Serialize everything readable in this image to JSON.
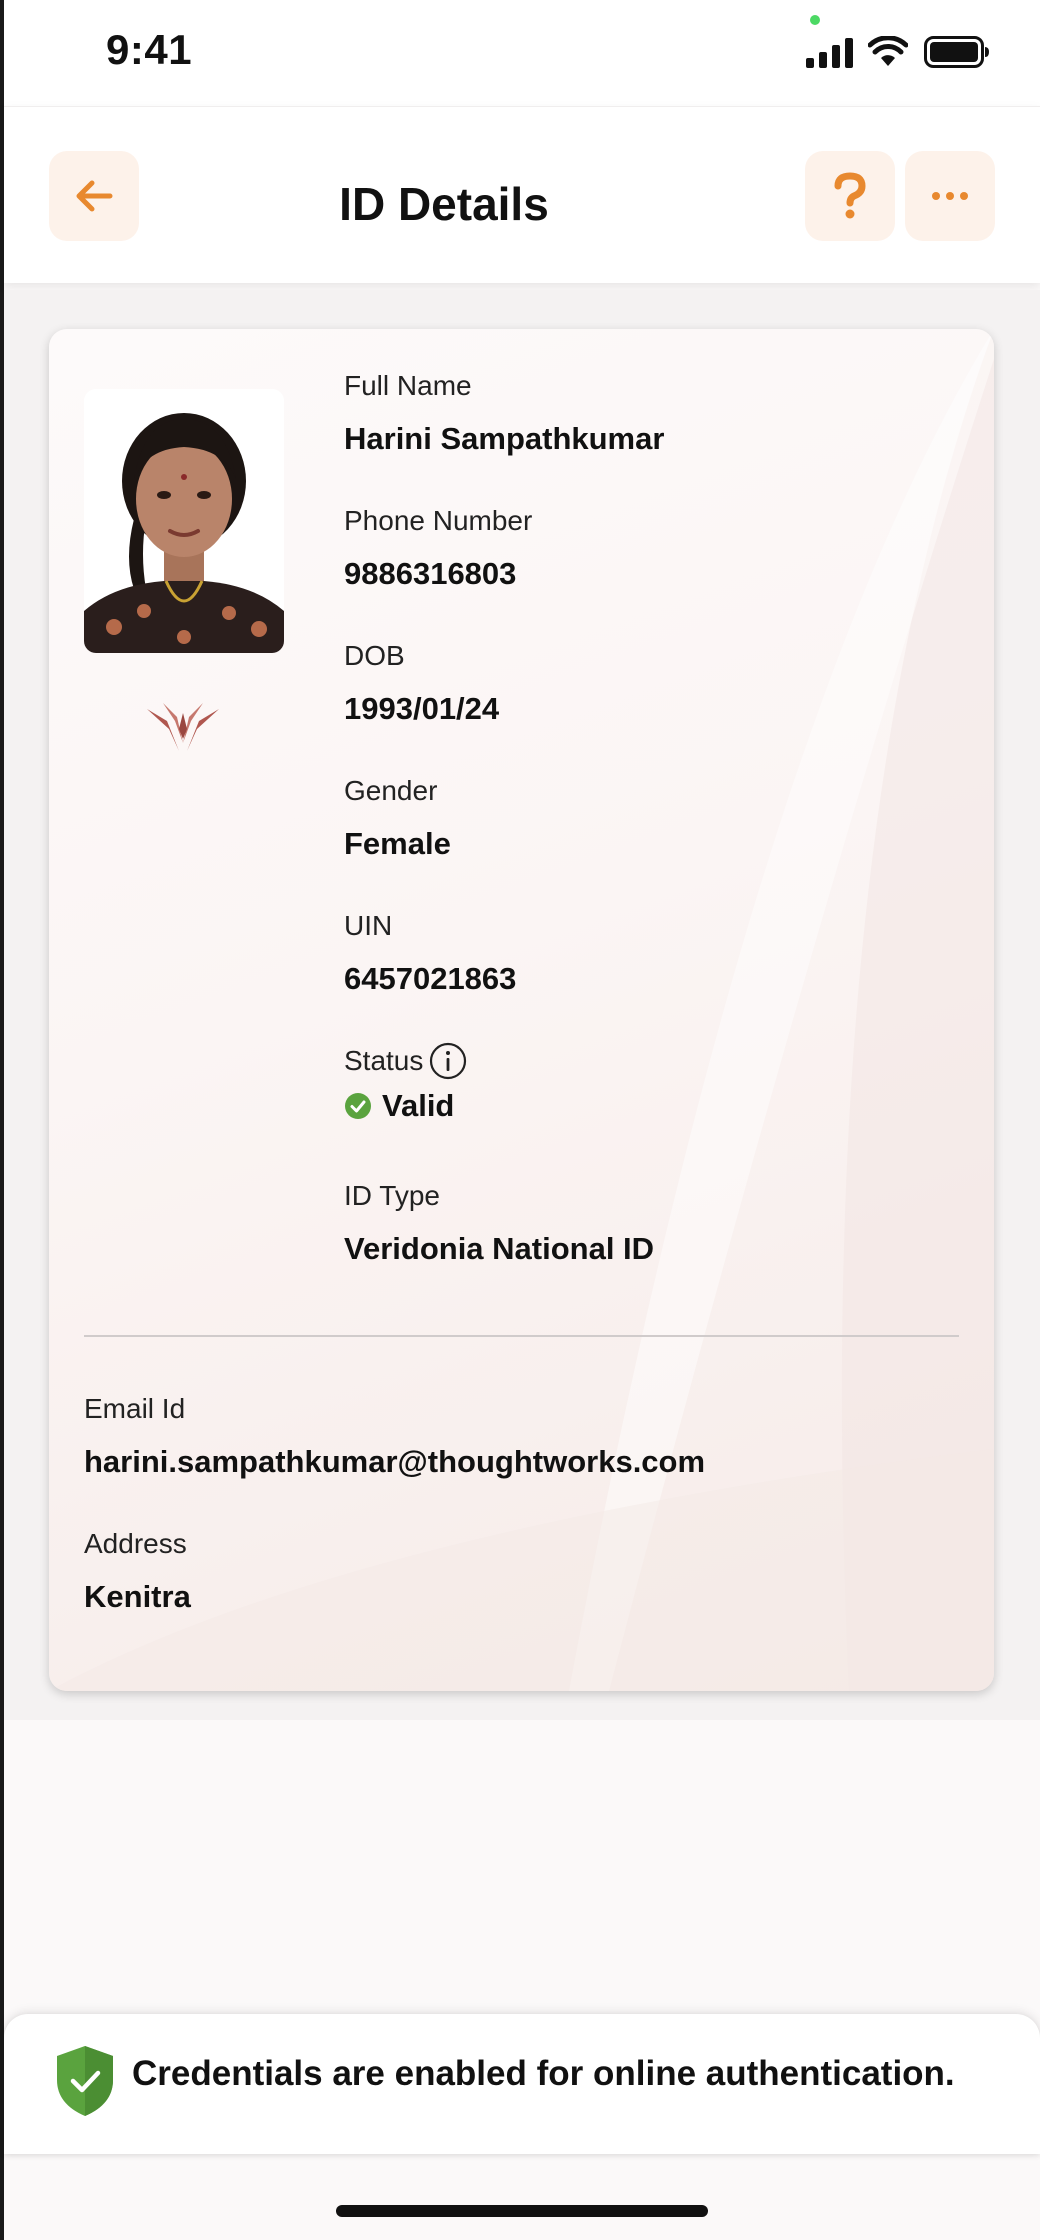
{
  "status_bar": {
    "time": "9:41"
  },
  "header": {
    "title": "ID Details",
    "back_icon": "arrow-left-icon",
    "help_icon": "question-mark-icon",
    "more_icon": "ellipsis-icon",
    "accent_color": "#e8892f",
    "button_bg_color": "#fdf2ea"
  },
  "card": {
    "fields": [
      {
        "label": "Full Name",
        "value": "Harini Sampathkumar"
      },
      {
        "label": "Phone Number",
        "value": "9886316803"
      },
      {
        "label": "DOB",
        "value": "1993/01/24"
      },
      {
        "label": "Gender",
        "value": "Female"
      },
      {
        "label": "UIN",
        "value": "6457021863"
      }
    ],
    "status": {
      "label": "Status",
      "value": "Valid",
      "status_color": "#5aa33e",
      "info_icon": "info-icon",
      "valid_icon": "check-circle-icon"
    },
    "id_type": {
      "label": "ID Type",
      "value": "Veridonia National ID"
    },
    "extra_fields": [
      {
        "label": "Email Id",
        "value": "harini.sampathkumar@thoughtworks.com"
      },
      {
        "label": "Address",
        "value": "Kenitra"
      }
    ]
  },
  "banner": {
    "text": "Credentials are enabled for online authentication.",
    "icon": "shield-check-icon",
    "icon_color": "#5aa33e"
  }
}
